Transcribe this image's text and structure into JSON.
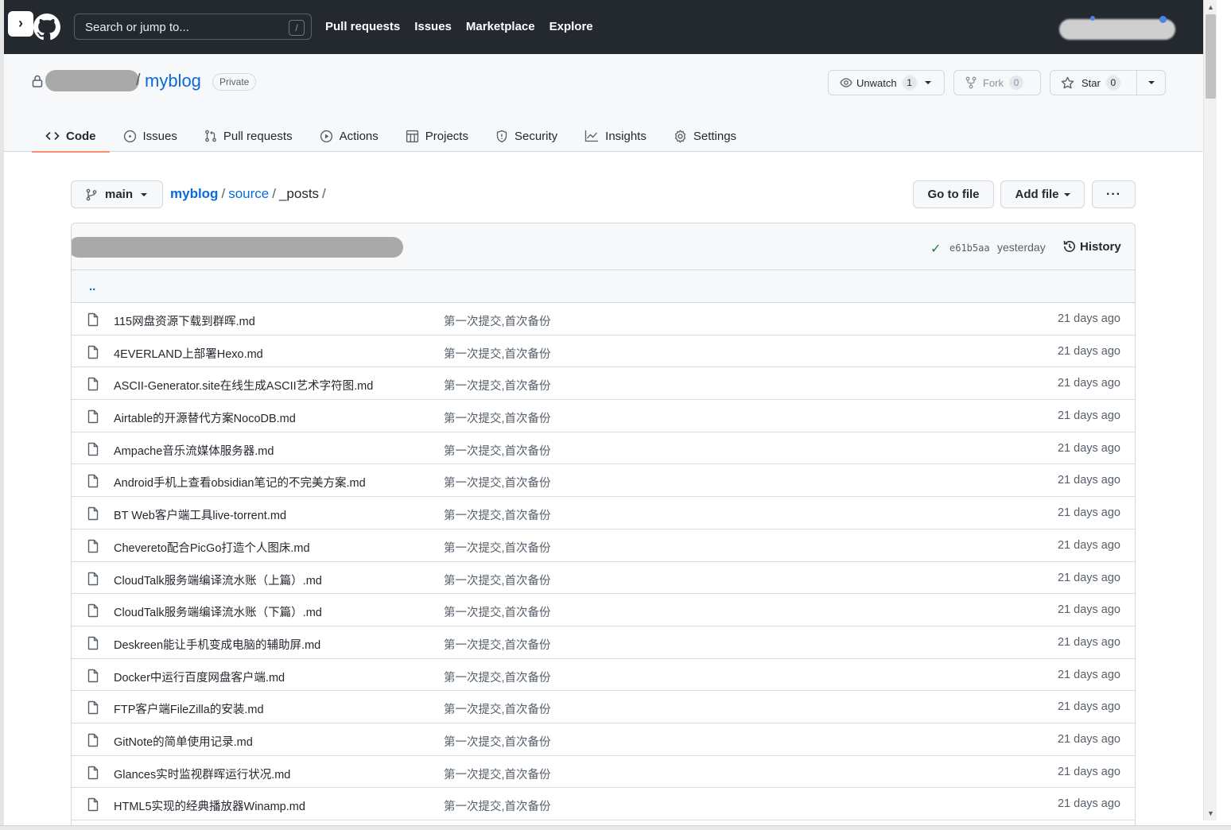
{
  "header": {
    "search_placeholder": "Search or jump to...",
    "search_shortcut": "/",
    "nav": [
      "Pull requests",
      "Issues",
      "Marketplace",
      "Explore"
    ]
  },
  "repo": {
    "name": "myblog",
    "visibility": "Private",
    "watch_label": "Unwatch",
    "watch_count": "1",
    "fork_label": "Fork",
    "fork_count": "0",
    "star_label": "Star",
    "star_count": "0"
  },
  "tabs": [
    {
      "label": "Code",
      "icon": "code-icon",
      "active": true
    },
    {
      "label": "Issues",
      "icon": "issue-icon"
    },
    {
      "label": "Pull requests",
      "icon": "pull-request-icon"
    },
    {
      "label": "Actions",
      "icon": "play-icon"
    },
    {
      "label": "Projects",
      "icon": "table-icon"
    },
    {
      "label": "Security",
      "icon": "shield-icon"
    },
    {
      "label": "Insights",
      "icon": "graph-icon"
    },
    {
      "label": "Settings",
      "icon": "gear-icon"
    }
  ],
  "file_nav": {
    "branch": "main",
    "breadcrumb": [
      "myblog",
      "source",
      "_posts"
    ],
    "separator": "/",
    "go_to_file": "Go to file",
    "add_file": "Add file",
    "more": "···"
  },
  "latest_commit": {
    "sha": "e61b5aa",
    "time": "yesterday",
    "history_label": "History"
  },
  "parent_dir": "..",
  "files": [
    {
      "name": "115网盘资源下载到群晖.md",
      "message": "第一次提交,首次备份",
      "age": "21 days ago"
    },
    {
      "name": "4EVERLAND上部署Hexo.md",
      "message": "第一次提交,首次备份",
      "age": "21 days ago"
    },
    {
      "name": "ASCII-Generator.site在线生成ASCII艺术字符图.md",
      "message": "第一次提交,首次备份",
      "age": "21 days ago"
    },
    {
      "name": "Airtable的开源替代方案NocoDB.md",
      "message": "第一次提交,首次备份",
      "age": "21 days ago"
    },
    {
      "name": "Ampache音乐流媒体服务器.md",
      "message": "第一次提交,首次备份",
      "age": "21 days ago"
    },
    {
      "name": "Android手机上查看obsidian笔记的不完美方案.md",
      "message": "第一次提交,首次备份",
      "age": "21 days ago"
    },
    {
      "name": "BT Web客户端工具live-torrent.md",
      "message": "第一次提交,首次备份",
      "age": "21 days ago"
    },
    {
      "name": "Chevereto配合PicGo打造个人图床.md",
      "message": "第一次提交,首次备份",
      "age": "21 days ago"
    },
    {
      "name": "CloudTalk服务端编译流水账（上篇）.md",
      "message": "第一次提交,首次备份",
      "age": "21 days ago"
    },
    {
      "name": "CloudTalk服务端编译流水账（下篇）.md",
      "message": "第一次提交,首次备份",
      "age": "21 days ago"
    },
    {
      "name": "Deskreen能让手机变成电脑的辅助屏.md",
      "message": "第一次提交,首次备份",
      "age": "21 days ago"
    },
    {
      "name": "Docker中运行百度网盘客户端.md",
      "message": "第一次提交,首次备份",
      "age": "21 days ago"
    },
    {
      "name": "FTP客户端FileZilla的安装.md",
      "message": "第一次提交,首次备份",
      "age": "21 days ago"
    },
    {
      "name": "GitNote的简单使用记录.md",
      "message": "第一次提交,首次备份",
      "age": "21 days ago"
    },
    {
      "name": "Glances实时监视群晖运行状况.md",
      "message": "第一次提交,首次备份",
      "age": "21 days ago"
    },
    {
      "name": "HTML5实现的经典播放器Winamp.md",
      "message": "第一次提交,首次备份",
      "age": "21 days ago"
    }
  ],
  "colors": {
    "header_bg": "#24292f",
    "link": "#0969da",
    "active_tab_underline": "#fd8c73",
    "success": "#1a7f37"
  }
}
